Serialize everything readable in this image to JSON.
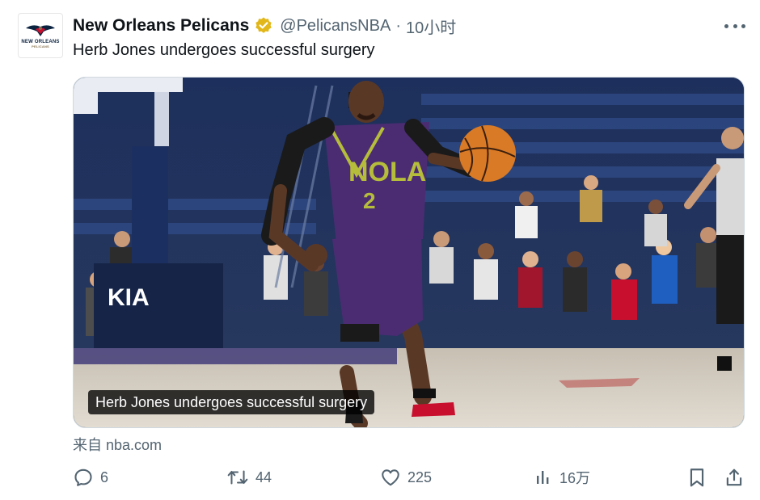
{
  "account": {
    "display_name": "New Orleans Pelicans",
    "handle": "@PelicansNBA",
    "separator": "·",
    "time": "10小时",
    "avatar_logo_text": "NEW ORLEANS",
    "avatar_logo_subtext": "PELICANS",
    "verified_color": "#e2b719"
  },
  "tweet": {
    "text": "Herb Jones undergoes successful surgery"
  },
  "media": {
    "caption": "Herb Jones undergoes successful surgery",
    "jersey_text": "NOLA",
    "jersey_number": "2",
    "jersey_color": "#4b2c73",
    "trim_color": "#b5bd3a",
    "court_sign": "KIA"
  },
  "card": {
    "source": "来自 nba.com"
  },
  "actions": {
    "replies": "6",
    "retweets": "44",
    "likes": "225",
    "views": "16万"
  },
  "icons": {
    "more": "more-dots-icon",
    "reply": "reply-icon",
    "retweet": "retweet-icon",
    "like": "heart-icon",
    "views": "bar-chart-icon",
    "bookmark": "bookmark-icon",
    "share": "share-icon"
  },
  "colors": {
    "text": "#0f1419",
    "secondary": "#536471",
    "border": "#cfd9de"
  }
}
